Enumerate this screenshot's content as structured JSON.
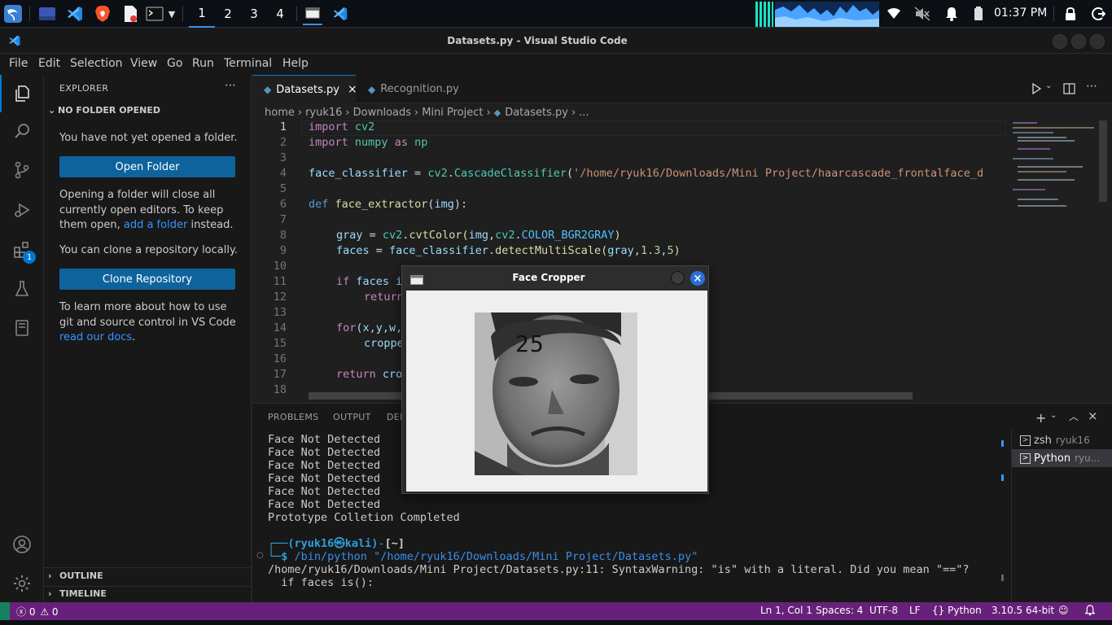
{
  "topbar": {
    "workspaces": [
      "1",
      "2",
      "3",
      "4"
    ],
    "clock": "01:37 PM"
  },
  "window": {
    "title": "Datasets.py - Visual Studio Code"
  },
  "menu": [
    "File",
    "Edit",
    "Selection",
    "View",
    "Go",
    "Run",
    "Terminal",
    "Help"
  ],
  "activity": {
    "extensions_badge": "1"
  },
  "sidebar": {
    "header": "EXPLORER",
    "section": "NO FOLDER OPENED",
    "msg1": "You have not yet opened a folder.",
    "open_folder": "Open Folder",
    "msg2_a": "Opening a folder will close all currently open editors. To keep them open,",
    "msg2_link": "add a folder",
    "msg2_b": "instead.",
    "msg3": "You can clone a repository locally.",
    "clone": "Clone Repository",
    "msg4_a": "To learn more about how to use git and source control in VS Code",
    "msg4_link": "read our docs",
    "msg4_b": ".",
    "outline": "OUTLINE",
    "timeline": "TIMELINE"
  },
  "tabs": [
    {
      "label": "Datasets.py",
      "active": true
    },
    {
      "label": "Recognition.py",
      "active": false
    }
  ],
  "breadcrumb": [
    "home",
    "ryuk16",
    "Downloads",
    "Mini Project",
    "Datasets.py",
    "..."
  ],
  "code": {
    "line_numbers": [
      "1",
      "2",
      "3",
      "4",
      "5",
      "6",
      "7",
      "8",
      "9",
      "10",
      "11",
      "12",
      "13",
      "14",
      "15",
      "16",
      "17",
      "18"
    ],
    "l1": [
      "import",
      " cv2"
    ],
    "l2": [
      "import",
      " numpy",
      " as",
      " np"
    ],
    "l4": [
      "face_classifier",
      " = ",
      "cv2",
      ".",
      "CascadeClassifier",
      "(",
      "'/home/ryuk16/Downloads/Mini Project/haarcascade_frontalface_d"
    ],
    "l6": [
      "def",
      " ",
      "face_extractor",
      "(",
      "img",
      "):"
    ],
    "l8": [
      "gray",
      " = ",
      "cv2",
      ".",
      "cvtColor",
      "(",
      "img",
      ",",
      "cv2",
      ".",
      "COLOR_BGR2GRAY",
      ")"
    ],
    "l9": [
      "faces",
      " = ",
      "face_classifier",
      ".",
      "detectMultiScale",
      "(",
      "gray",
      ",",
      "1.3",
      ",",
      "5",
      ")"
    ],
    "l11": [
      "if",
      " faces i"
    ],
    "l12": [
      "return"
    ],
    "l14": [
      "for",
      "(x,y,w,"
    ],
    "l15": [
      "croppe"
    ],
    "l17": [
      "return",
      " cro"
    ]
  },
  "panel": {
    "tabs": [
      "PROBLEMS",
      "OUTPUT",
      "DEB"
    ],
    "output": [
      "Face Not Detected",
      "Face Not Detected",
      "Face Not Detected",
      "Face Not Detected",
      "Face Not Detected",
      "Face Not Detected",
      "Prototype Colletion Completed"
    ],
    "prompt_user": "(ryuk16㉿kali)",
    "prompt_dir": "[~]",
    "command": "/bin/python \"/home/ryuk16/Downloads/Mini Project/Datasets.py\"",
    "warning": "/home/ryuk16/Downloads/Mini Project/Datasets.py:11: SyntaxWarning: \"is\" with a literal. Did you mean \"==\"?",
    "warning_src": "  if faces is():",
    "terminals": [
      {
        "name": "zsh",
        "user": "ryuk16"
      },
      {
        "name": "Python",
        "user": "ryu..."
      }
    ]
  },
  "face_window": {
    "title": "Face Cropper",
    "count": "25"
  },
  "status": {
    "errors": "0",
    "warnings": "0",
    "position": "Ln 1, Col 1",
    "spaces": "Spaces: 4",
    "encoding": "UTF-8",
    "eol": "LF",
    "language": "Python",
    "interpreter": "3.10.5 64-bit"
  },
  "colors": {
    "status_bar": "#68217a",
    "accent": "#0e639c",
    "link": "#3794ff"
  }
}
